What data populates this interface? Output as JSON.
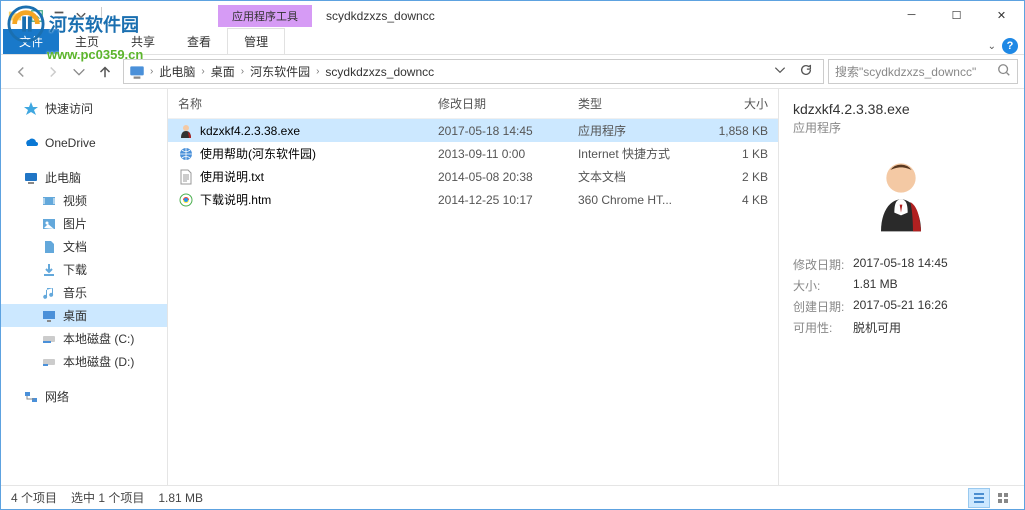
{
  "titlebar": {
    "contextual_tab": "应用程序工具",
    "title": "scydkdzxzs_downcc"
  },
  "ribbon": {
    "file": "文件",
    "tabs": [
      "主页",
      "共享",
      "查看"
    ],
    "tool_tab": "管理"
  },
  "breadcrumb": [
    "此电脑",
    "桌面",
    "河东软件园",
    "scydkdzxzs_downcc"
  ],
  "search": {
    "placeholder": "搜索\"scydkdzxzs_downcc\""
  },
  "nav": {
    "quick": "快速访问",
    "onedrive": "OneDrive",
    "thispc": "此电脑",
    "video": "视频",
    "pictures": "图片",
    "documents": "文档",
    "downloads": "下载",
    "music": "音乐",
    "desktop": "桌面",
    "drive_c": "本地磁盘 (C:)",
    "drive_d": "本地磁盘 (D:)",
    "network": "网络"
  },
  "columns": {
    "name": "名称",
    "date": "修改日期",
    "type": "类型",
    "size": "大小"
  },
  "files": [
    {
      "name": "kdzxkf4.2.3.38.exe",
      "date": "2017-05-18 14:45",
      "type": "应用程序",
      "size": "1,858 KB",
      "icon": "exe",
      "selected": true
    },
    {
      "name": "使用帮助(河东软件园)",
      "date": "2013-09-11 0:00",
      "type": "Internet 快捷方式",
      "size": "1 KB",
      "icon": "url",
      "selected": false
    },
    {
      "name": "使用说明.txt",
      "date": "2014-05-08 20:38",
      "type": "文本文档",
      "size": "2 KB",
      "icon": "txt",
      "selected": false
    },
    {
      "name": "下载说明.htm",
      "date": "2014-12-25 10:17",
      "type": "360 Chrome HT...",
      "size": "4 KB",
      "icon": "htm",
      "selected": false
    }
  ],
  "details": {
    "title": "kdzxkf4.2.3.38.exe",
    "type": "应用程序",
    "rows": [
      {
        "label": "修改日期:",
        "value": "2017-05-18 14:45"
      },
      {
        "label": "大小:",
        "value": "1.81 MB"
      },
      {
        "label": "创建日期:",
        "value": "2017-05-21 16:26"
      },
      {
        "label": "可用性:",
        "value": "脱机可用"
      }
    ]
  },
  "status": {
    "items": "4 个项目",
    "selected": "选中 1 个项目",
    "size": "1.81 MB"
  },
  "watermark": {
    "text": "河东软件园",
    "url": "www.pc0359.cn"
  }
}
